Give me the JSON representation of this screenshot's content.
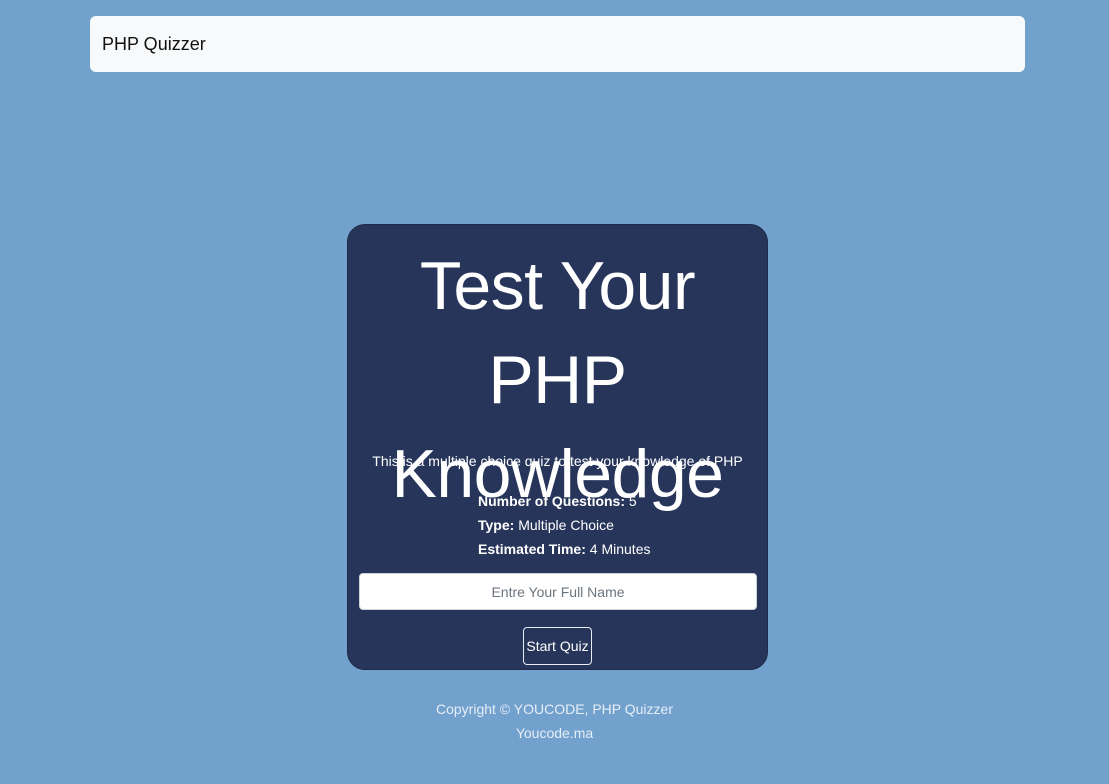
{
  "navbar": {
    "brand": "PHP Quizzer"
  },
  "card": {
    "title_line1": "Test Your PHP",
    "title_line2": "Knowledge",
    "lead": "This is a multiple choice quiz to test your knowledge of PHP",
    "info": [
      {
        "label": "Number of Questions:",
        "value": "5"
      },
      {
        "label": "Type:",
        "value": "Multiple Choice"
      },
      {
        "label": "Estimated Time:",
        "value": "4 Minutes"
      }
    ],
    "name_input": {
      "placeholder": "Entre Your Full Name",
      "value": ""
    },
    "start_button": "Start Quiz"
  },
  "footer": {
    "copyright": "Copyright © YOUCODE, PHP Quizzer",
    "link": "Youcode.ma"
  },
  "colors": {
    "page_background": "#72a1cd",
    "card_background": "#27355a",
    "navbar_background": "#f8f9fa"
  }
}
